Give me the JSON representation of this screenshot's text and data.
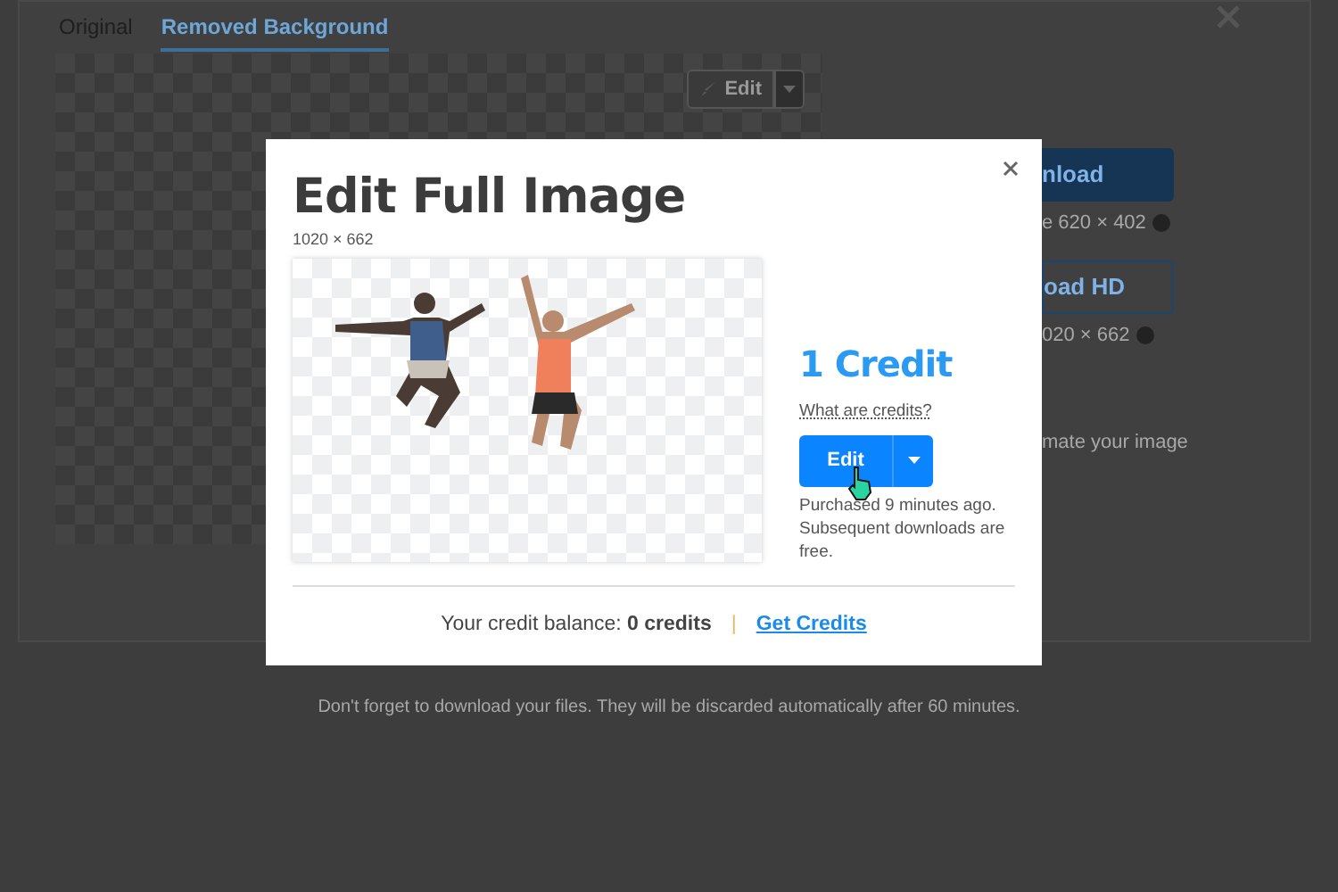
{
  "background_page": {
    "tabs": [
      {
        "label": "Original",
        "selected": false
      },
      {
        "label": "Removed Background",
        "selected": true
      }
    ],
    "edit_button": "Edit",
    "download_button": "nload",
    "download_size": "e 620 × 402",
    "download_hd_button": "oad HD",
    "download_hd_size": "020 × 662",
    "note": "mate your image",
    "footer_notice": "Don't forget to download your files. They will be discarded automatically after 60 minutes."
  },
  "dialog": {
    "title": "Edit Full Image",
    "dimensions": "1020 × 662",
    "price": "1 Credit",
    "credits_link": "What are credits?",
    "edit_button": "Edit",
    "purchase_note": "Purchased 9 minutes ago. Subsequent downloads are free.",
    "balance_text": "Your credit balance: **0 credits**",
    "separator": "|",
    "get_credits_link": "Get Credits"
  }
}
